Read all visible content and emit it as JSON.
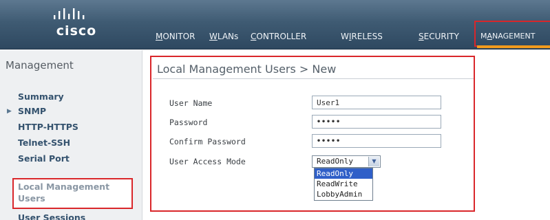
{
  "brand": {
    "logo_text": "cisco"
  },
  "nav": {
    "items": [
      {
        "pre": "",
        "u": "M",
        "post": "ONITOR"
      },
      {
        "pre": "",
        "u": "W",
        "post": "LANs"
      },
      {
        "pre": "",
        "u": "C",
        "post": "ONTROLLER"
      },
      {
        "pre": "W",
        "u": "I",
        "post": "RELESS"
      },
      {
        "pre": "",
        "u": "S",
        "post": "ECURITY"
      },
      {
        "pre": "M",
        "u": "A",
        "post": "NAGEMENT"
      }
    ]
  },
  "sidebar": {
    "title": "Management",
    "items": [
      {
        "label": "Summary"
      },
      {
        "label": "SNMP"
      },
      {
        "label": "HTTP-HTTPS"
      },
      {
        "label": "Telnet-SSH"
      },
      {
        "label": "Serial Port"
      },
      {
        "label": "Local Management Users"
      },
      {
        "label": "User Sessions"
      }
    ]
  },
  "main": {
    "title": "Local Management Users > New",
    "form": {
      "user_name_label": "User Name",
      "user_name_value": "User1",
      "password_label": "Password",
      "password_value": "•••••",
      "confirm_password_label": "Confirm Password",
      "confirm_password_value": "•••••",
      "access_mode_label": "User Access Mode",
      "access_mode_selected": "ReadOnly",
      "access_mode_options": [
        "ReadOnly",
        "ReadWrite",
        "LobbyAdmin"
      ]
    }
  },
  "colors": {
    "header": "#3f5b73",
    "highlight_box": "#d9262a",
    "nav_active_underline": "#f29b1d",
    "dropdown_selection": "#2f5fc8"
  },
  "icons": {
    "expand": "triangle-right-icon",
    "select_arrow": "chevron-down-icon"
  }
}
